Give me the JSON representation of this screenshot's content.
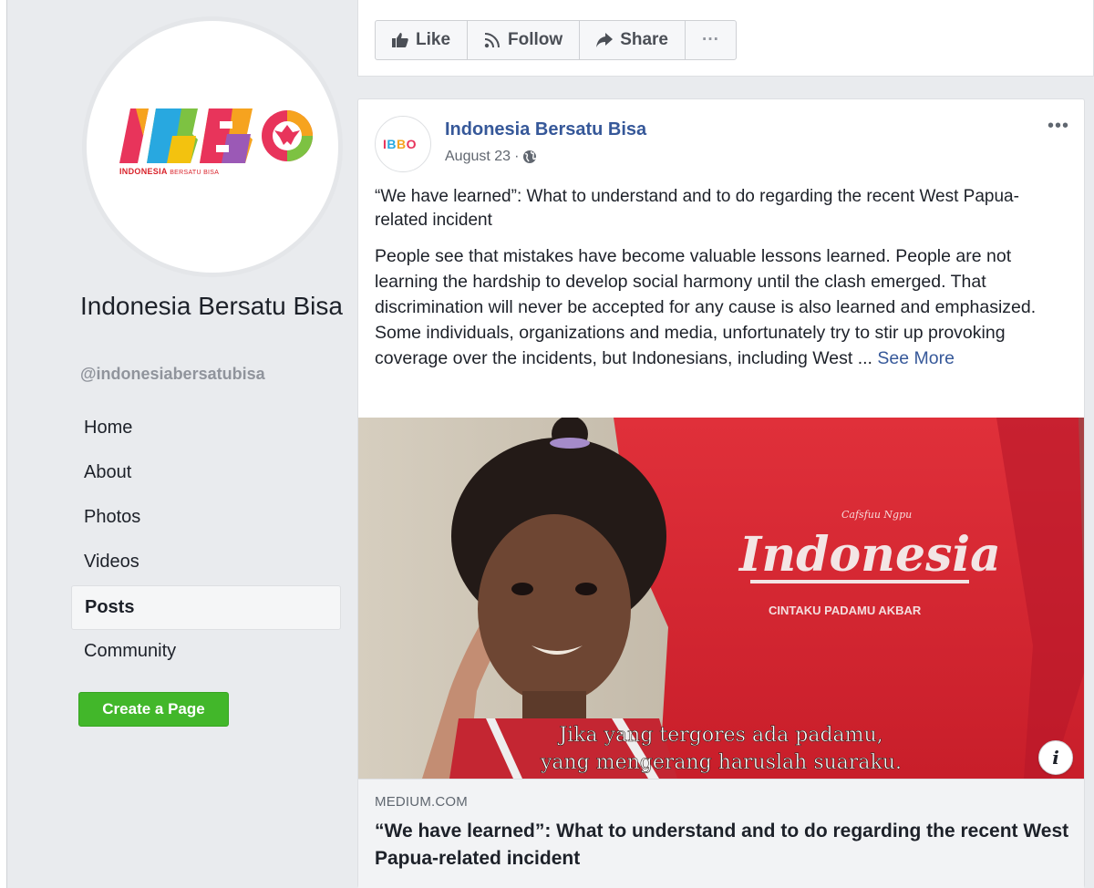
{
  "page": {
    "name": "Indonesia Bersatu Bisa",
    "handle": "@indonesiabersatubisa",
    "logo_text": "IBBO",
    "logo_caption_main": "INDONESIA",
    "logo_caption_small": "BERSATU BISA"
  },
  "nav": {
    "items": [
      {
        "label": "Home"
      },
      {
        "label": "About"
      },
      {
        "label": "Photos"
      },
      {
        "label": "Videos"
      },
      {
        "label": "Posts"
      },
      {
        "label": "Community"
      }
    ],
    "active": "Posts"
  },
  "create_page_label": "Create a Page",
  "actions": {
    "like": "Like",
    "follow": "Follow",
    "share": "Share",
    "more": "···"
  },
  "post": {
    "author": "Indonesia Bersatu Bisa",
    "date": "August 23",
    "separator": "·",
    "menu": "•••",
    "title_text": "“We have learned”: What to understand and to do regarding the recent West Papua-related incident",
    "body": "People see that mistakes have become valuable lessons learned. People are not learning the hardship to develop social harmony until the clash emerged. That discrimination will never be accepted for any cause is also learned and emphasized. Some individuals, organizations and media, unfortunately try to stir up provoking coverage over the incidents, but Indonesians, including West ...",
    "see_more": "See More",
    "image": {
      "shirt_small": "Cafsfuu Ngpu",
      "shirt_big": "Indonesia",
      "shirt_sub": "CINTAKU PADAMU AKBAR",
      "caption_line1": "Jika yang tergores ada padamu,",
      "caption_line2": "yang mengerang haruslah suaraku."
    },
    "link": {
      "domain": "MEDIUM.COM",
      "title": "“We have learned”: What to understand and to do regarding the recent West Papua-related incident"
    },
    "info_icon": "i"
  },
  "colors": {
    "accent_blue": "#365899",
    "create_green": "#42b72a",
    "shirt_red": "#d8202e"
  }
}
